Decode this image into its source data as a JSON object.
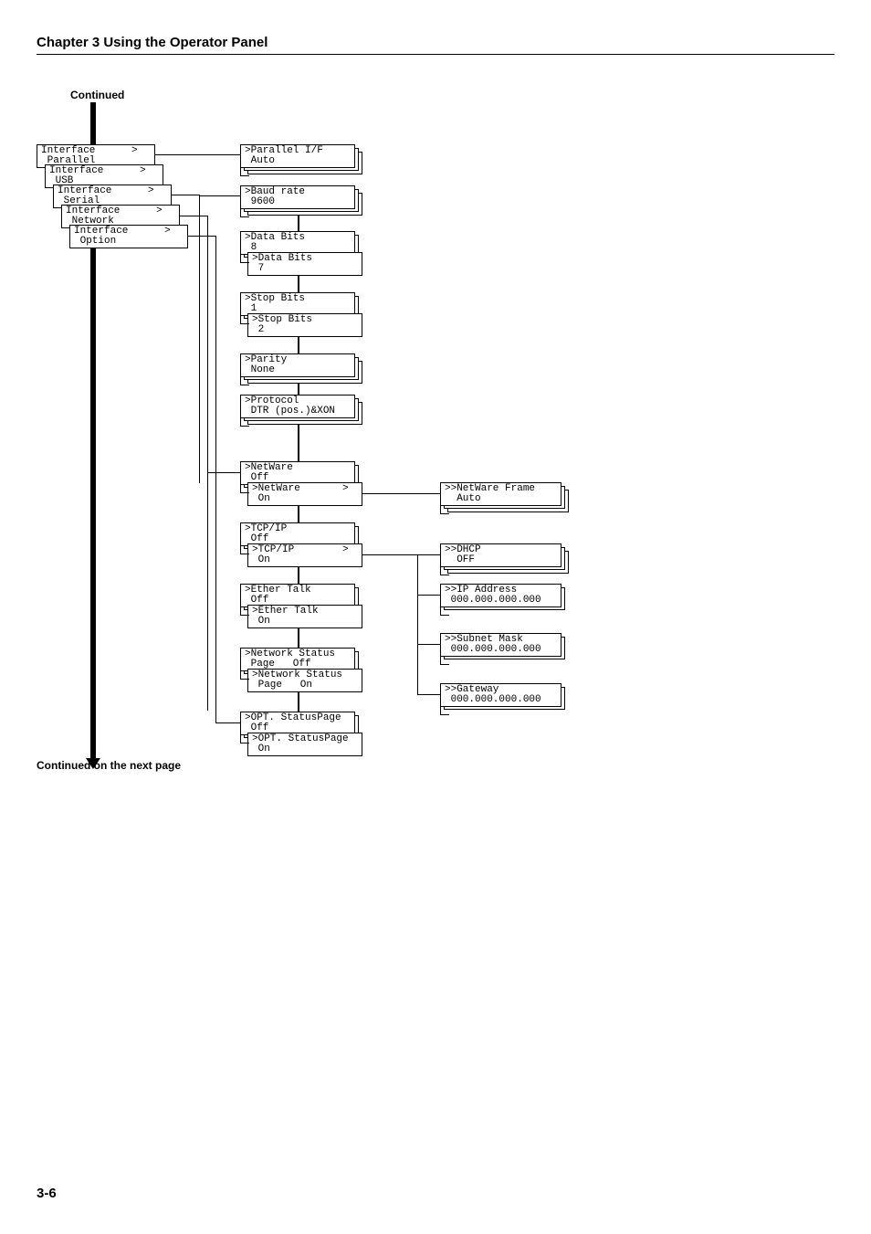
{
  "header": "Chapter 3  Using the Operator Panel",
  "continued": "Continued",
  "continued_next": "Continued on the next page",
  "page_num": "3-6",
  "col1": {
    "if_parallel": "Interface      >\n Parallel",
    "if_usb": "Interface      >\n USB",
    "if_serial": "Interface      >\n Serial",
    "if_network": "Interface      >\n Network",
    "if_option": "Interface      >\n Option"
  },
  "col2": {
    "parallel_if": ">Parallel I/F\n Auto",
    "baud": ">Baud rate\n 9600",
    "databits8": ">Data Bits\n 8",
    "databits7": ">Data Bits\n 7",
    "stopbits1": ">Stop Bits\n 1",
    "stopbits2": ">Stop Bits\n 2",
    "parity": ">Parity\n None",
    "protocol": ">Protocol\n DTR (pos.)&XON",
    "netware_off": ">NetWare\n Off",
    "netware_on": ">NetWare       >\n On",
    "tcpip_off": ">TCP/IP\n Off",
    "tcpip_on": ">TCP/IP        >\n On",
    "ether_off": ">Ether Talk\n Off",
    "ether_on": ">Ether Talk\n On",
    "netstat_off": ">Network Status\n Page   Off",
    "netstat_on": ">Network Status\n Page   On",
    "optstat_off": ">OPT. StatusPage\n Off",
    "optstat_on": ">OPT. StatusPage\n On"
  },
  "col3": {
    "netware_frame": ">>NetWare Frame\n  Auto",
    "dhcp": ">>DHCP\n  OFF",
    "ip": ">>IP Address\n 000.000.000.000",
    "subnet": ">>Subnet Mask\n 000.000.000.000",
    "gateway": ">>Gateway\n 000.000.000.000"
  }
}
